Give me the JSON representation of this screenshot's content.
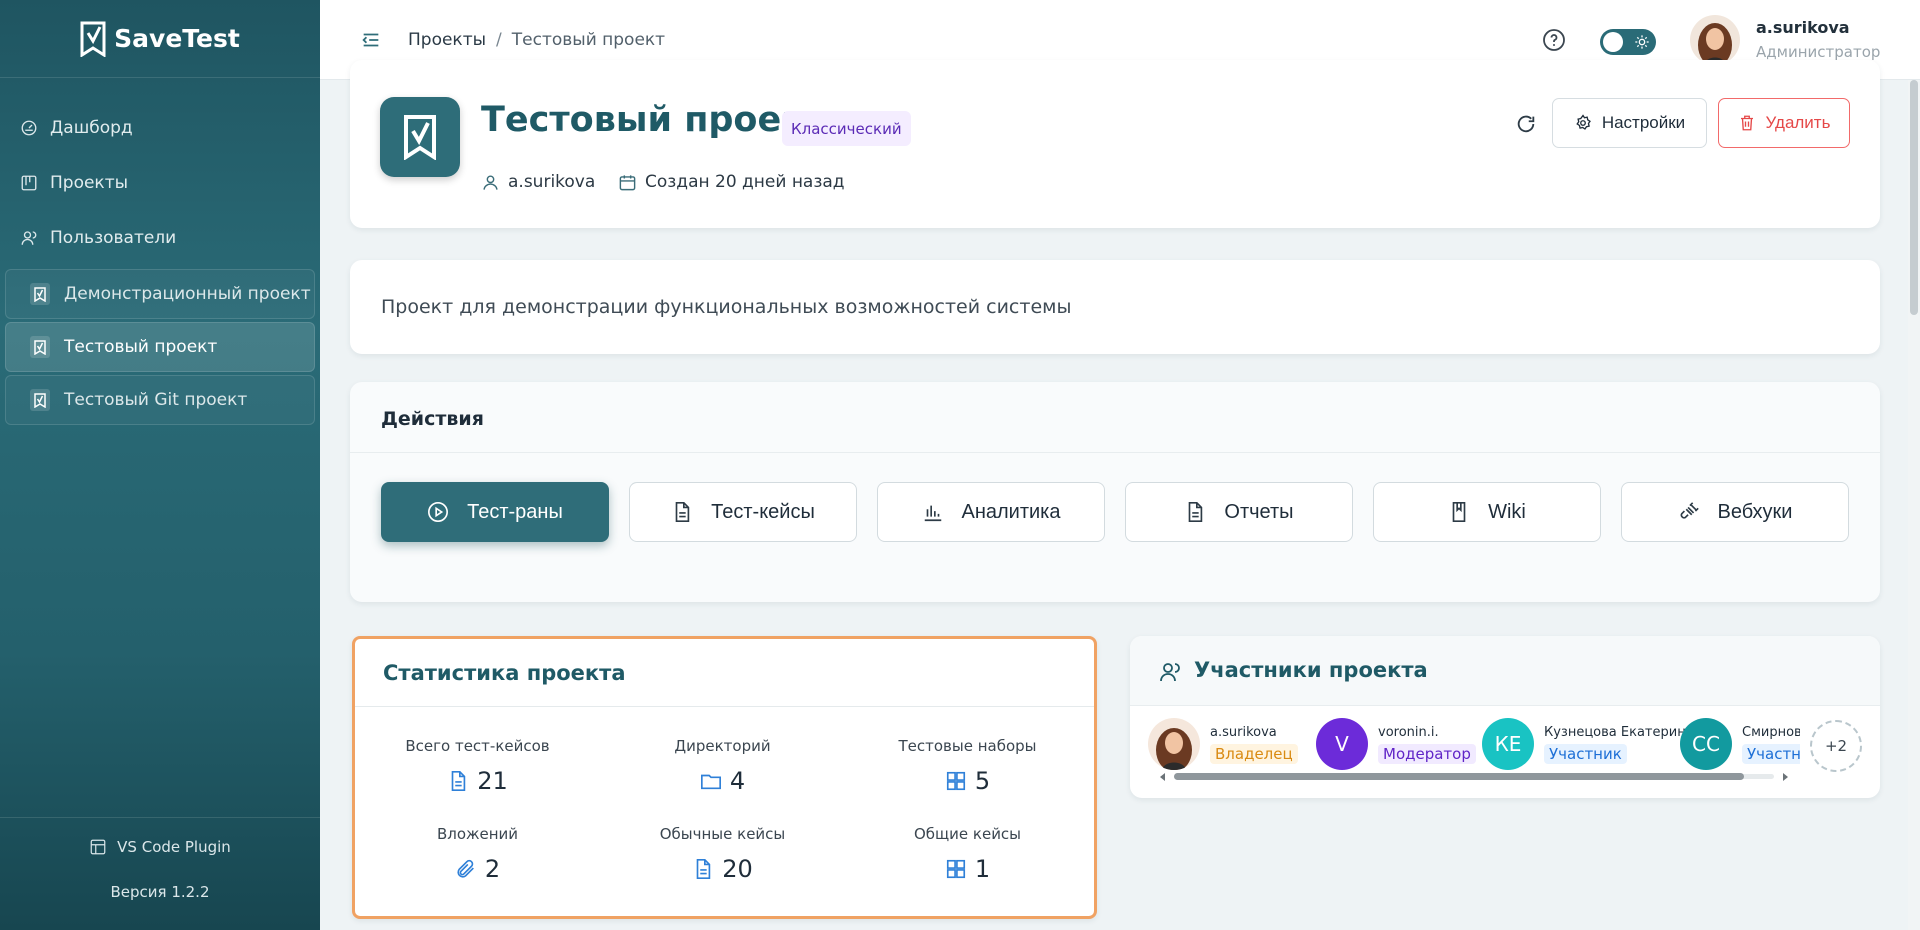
{
  "app": {
    "name": "SaveTest"
  },
  "sidebar": {
    "nav": [
      {
        "label": "Дашборд",
        "icon": "dashboard-icon"
      },
      {
        "label": "Проекты",
        "icon": "projects-icon"
      },
      {
        "label": "Пользователи",
        "icon": "users-icon"
      }
    ],
    "projects": [
      {
        "label": "Демонстрационный проект",
        "active": false
      },
      {
        "label": "Тестовый проект",
        "active": true
      },
      {
        "label": "Тестовый Git проект",
        "active": false
      }
    ],
    "plugin_label": "VS Code Plugin",
    "version": "Версия 1.2.2"
  },
  "header": {
    "breadcrumb": {
      "root": "Проекты",
      "separator": "/",
      "current": "Тестовый проект"
    },
    "user": {
      "name": "a.surikova",
      "role": "Администратор"
    }
  },
  "project": {
    "title": "Тестовый проект",
    "badge": "Классический",
    "owner": "a.surikova",
    "created": "Создан 20 дней назад",
    "settings_label": "Настройки",
    "delete_label": "Удалить",
    "description": "Проект для демонстрации функциональных возможностей системы"
  },
  "actions": {
    "title": "Действия",
    "buttons": [
      {
        "label": "Тест-раны",
        "icon": "play-circle-icon"
      },
      {
        "label": "Тест-кейсы",
        "icon": "document-icon"
      },
      {
        "label": "Аналитика",
        "icon": "bar-chart-icon"
      },
      {
        "label": "Отчеты",
        "icon": "report-icon"
      },
      {
        "label": "Wiki",
        "icon": "book-icon"
      },
      {
        "label": "Вебхуки",
        "icon": "plug-icon"
      }
    ]
  },
  "stats": {
    "title": "Статистика проекта",
    "items": [
      {
        "label": "Всего тест-кейсов",
        "value": "21",
        "icon": "document-icon"
      },
      {
        "label": "Директорий",
        "value": "4",
        "icon": "folder-icon"
      },
      {
        "label": "Тестовые наборы",
        "value": "5",
        "icon": "grid-icon"
      },
      {
        "label": "Вложений",
        "value": "2",
        "icon": "paperclip-icon"
      },
      {
        "label": "Обычные кейсы",
        "value": "20",
        "icon": "document-icon"
      },
      {
        "label": "Общие кейсы",
        "value": "1",
        "icon": "grid-icon"
      }
    ]
  },
  "members": {
    "title": "Участники проекта",
    "list": [
      {
        "name": "a.surikova",
        "role": "Владелец",
        "initials": "",
        "color": "#f3c9a0",
        "role_bg": "#fff4e0",
        "role_fg": "#d98a12"
      },
      {
        "name": "voronin.i.",
        "role": "Модератор",
        "initials": "V",
        "color": "#6c2bd9",
        "role_bg": "#f1eaff",
        "role_fg": "#6025c7"
      },
      {
        "name": "Кузнецова Екатерина",
        "role": "Участник",
        "initials": "КЕ",
        "color": "#19c3c3",
        "role_bg": "#e6f2ff",
        "role_fg": "#1d6fd6"
      },
      {
        "name": "Смирнов",
        "role": "Участник",
        "initials": "СС",
        "color": "#129a9f",
        "role_bg": "#e6f2ff",
        "role_fg": "#1d6fd6"
      }
    ],
    "more": "+2"
  },
  "colors": {
    "primary": "#2f6d79",
    "accent_orange": "#f0a263",
    "danger": "#e54848"
  }
}
